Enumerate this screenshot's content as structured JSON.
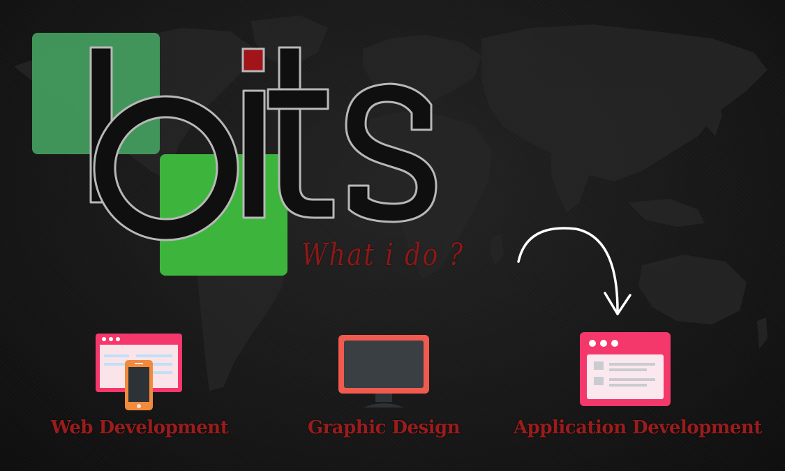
{
  "logo": {
    "text": "bits",
    "colors": {
      "square_light": "#45a060",
      "square_bright": "#3db53d",
      "letter_fill": "#0f0f0f",
      "letter_outline": "#b8b8b8",
      "dot": "#a0141a"
    }
  },
  "tagline": "What i do ?",
  "services": [
    {
      "label": "Web Development",
      "icon": "web-browser-phone-icon"
    },
    {
      "label": "Graphic Design",
      "icon": "monitor-icon"
    },
    {
      "label": "Application Development",
      "icon": "app-window-icon"
    }
  ],
  "colors": {
    "background": "#171717",
    "text_red": "#9b1c1c",
    "icon_pink": "#f5386b",
    "icon_orange": "#f28a3c",
    "icon_coral": "#f05a4f"
  }
}
